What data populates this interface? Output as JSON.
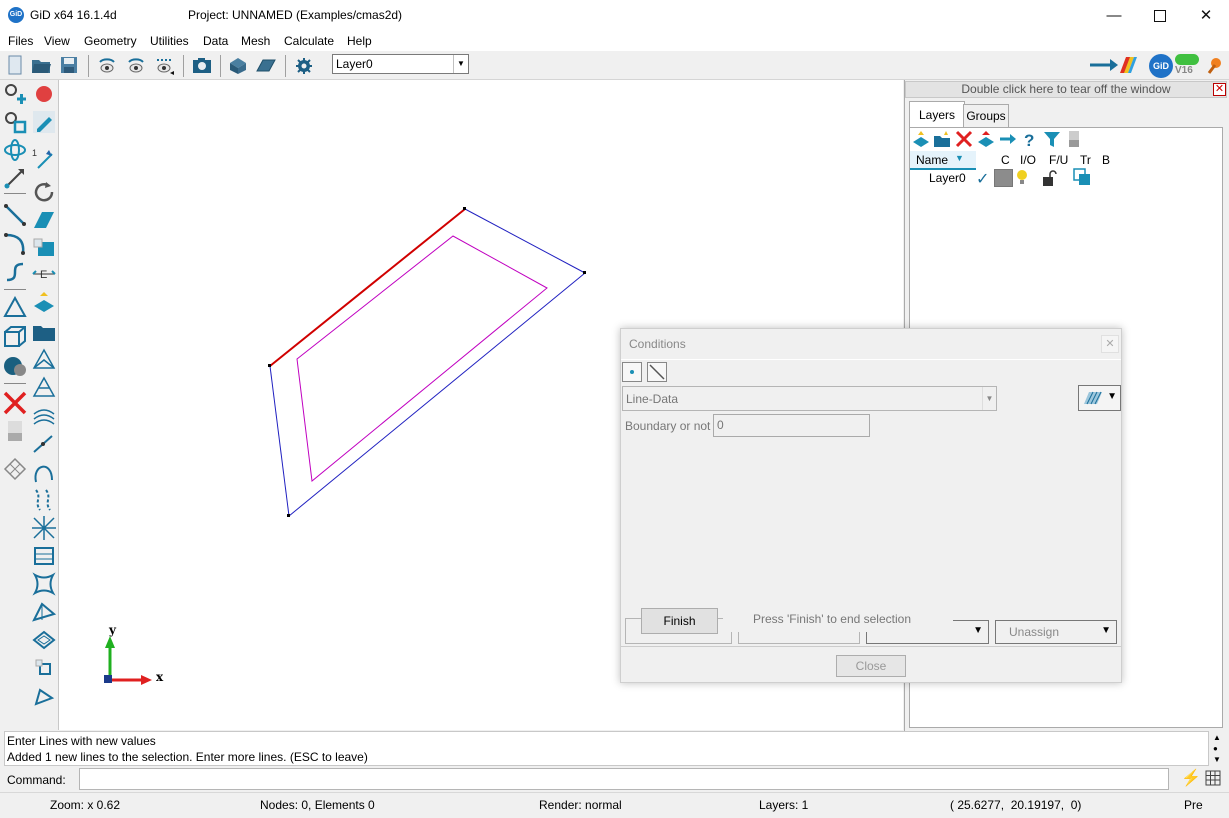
{
  "window": {
    "app_title": "GiD x64 16.1.4d",
    "project_title": "Project: UNNAMED (Examples/cmas2d)",
    "app_icon_text": "GiD",
    "controls": [
      "minimize-icon",
      "maximize-icon",
      "close-icon"
    ]
  },
  "menu": [
    "Files",
    "View",
    "Geometry",
    "Utilities",
    "Data",
    "Mesh",
    "Calculate",
    "Help"
  ],
  "toolbar": {
    "layer_select": "Layer0",
    "icons": [
      "new-icon",
      "open-folder-icon",
      "save-icon",
      "view-rotate-icon",
      "view-rotate-icon",
      "view-zoom-icon",
      "screenshot-camera-icon",
      "mesh-icon",
      "surface-icon",
      "settings-gear-icon"
    ],
    "right_icons": [
      "preprocess-arrow-icon",
      "gid-logo-icon",
      "toggle-switch-icon",
      "wizard-icon"
    ],
    "version_label": "V16"
  },
  "canvas": {
    "axis_y_label": "y",
    "axis_x_label": "x"
  },
  "right_panel": {
    "tearoff_text": "Double click here to tear off the window",
    "tabs": [
      "Layers",
      "Groups"
    ],
    "columns": [
      "Name",
      "C",
      "I/O",
      "F/U",
      "Tr",
      "B"
    ],
    "layer_row": {
      "name": "Layer0",
      "color": "#8c8c8c"
    },
    "icons": [
      "new-layer-icon",
      "new-child-layer-icon",
      "delete-icon",
      "layer-to-use-icon",
      "send-to-layer-icon",
      "help-icon",
      "filter-icon",
      "close-panel-icon"
    ]
  },
  "conditions_dialog": {
    "title": "Conditions",
    "condition_select": "Line-Data",
    "field_label": "Boundary or not",
    "field_value": "0",
    "finish_label": "Finish",
    "finish_hint": "Press 'Finish' to end selection",
    "unassign_label": "Unassign",
    "close_label": "Close"
  },
  "messages": [
    "Enter Lines with new values",
    "Added 1 new  lines to the selection. Enter more lines. (ESC to leave)"
  ],
  "command": {
    "label": "Command:",
    "value": ""
  },
  "status": {
    "zoom": "Zoom: x 0.62",
    "nodes": "Nodes: 0, Elements 0",
    "render": "Render: normal",
    "layers": "Layers: 1",
    "coords": "( 25.6277,  20.19197,  0)",
    "mode": "Pre"
  },
  "colors": {
    "accent": "#1a8fb5",
    "selected_line": "#d00000",
    "geometry_line": "#2020c0",
    "surface_outline": "#c000c0",
    "axis_x": "#e02020",
    "axis_y": "#20b020"
  }
}
